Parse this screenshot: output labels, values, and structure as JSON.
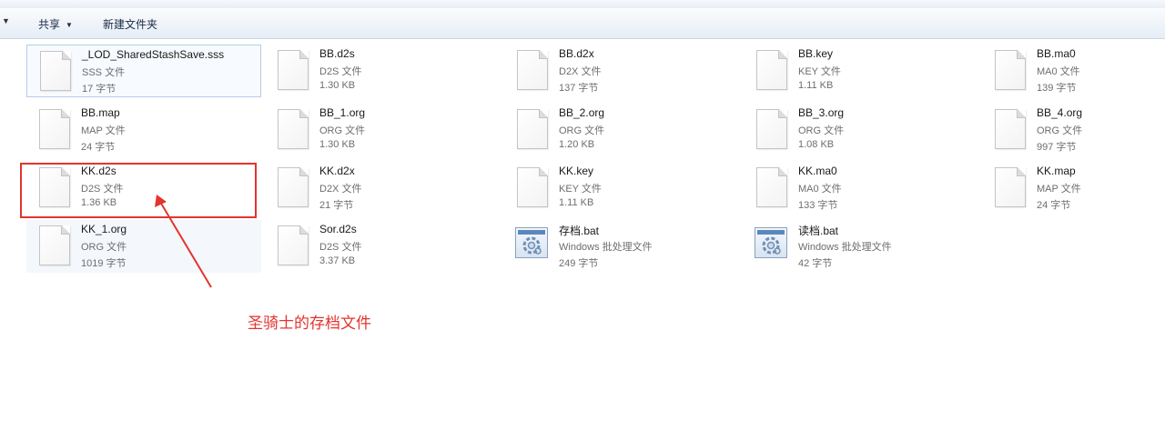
{
  "toolbar": {
    "share_label": "共享",
    "new_folder_label": "新建文件夹"
  },
  "files": [
    {
      "name": "_LOD_SharedStashSave.sss",
      "type": "SSS 文件",
      "size": "17 字节",
      "icon": "generic-file-icon"
    },
    {
      "name": "BB.d2s",
      "type": "D2S 文件",
      "size": "1.30 KB",
      "icon": "generic-file-icon"
    },
    {
      "name": "BB.d2x",
      "type": "D2X 文件",
      "size": "137 字节",
      "icon": "generic-file-icon"
    },
    {
      "name": "BB.key",
      "type": "KEY 文件",
      "size": "1.11 KB",
      "icon": "generic-file-icon"
    },
    {
      "name": "BB.ma0",
      "type": "MA0 文件",
      "size": "139 字节",
      "icon": "generic-file-icon"
    },
    {
      "name": "BB.map",
      "type": "MAP 文件",
      "size": "24 字节",
      "icon": "generic-file-icon"
    },
    {
      "name": "BB_1.org",
      "type": "ORG 文件",
      "size": "1.30 KB",
      "icon": "generic-file-icon"
    },
    {
      "name": "BB_2.org",
      "type": "ORG 文件",
      "size": "1.20 KB",
      "icon": "generic-file-icon"
    },
    {
      "name": "BB_3.org",
      "type": "ORG 文件",
      "size": "1.08 KB",
      "icon": "generic-file-icon"
    },
    {
      "name": "BB_4.org",
      "type": "ORG 文件",
      "size": "997 字节",
      "icon": "generic-file-icon"
    },
    {
      "name": "KK.d2s",
      "type": "D2S 文件",
      "size": "1.36 KB",
      "icon": "generic-file-icon"
    },
    {
      "name": "KK.d2x",
      "type": "D2X 文件",
      "size": "21 字节",
      "icon": "generic-file-icon"
    },
    {
      "name": "KK.key",
      "type": "KEY 文件",
      "size": "1.11 KB",
      "icon": "generic-file-icon"
    },
    {
      "name": "KK.ma0",
      "type": "MA0 文件",
      "size": "133 字节",
      "icon": "generic-file-icon"
    },
    {
      "name": "KK.map",
      "type": "MAP 文件",
      "size": "24 字节",
      "icon": "generic-file-icon"
    },
    {
      "name": "KK_1.org",
      "type": "ORG 文件",
      "size": "1019 字节",
      "icon": "generic-file-icon"
    },
    {
      "name": "Sor.d2s",
      "type": "D2S 文件",
      "size": "3.37 KB",
      "icon": "generic-file-icon"
    },
    {
      "name": "存档.bat",
      "type": "Windows 批处理文件",
      "size": "249 字节",
      "icon": "batch-file-icon"
    },
    {
      "name": "读档.bat",
      "type": "Windows 批处理文件",
      "size": "42 字节",
      "icon": "batch-file-icon"
    }
  ],
  "annotation": {
    "text": "圣骑士的存档文件",
    "color": "#e3342f"
  }
}
